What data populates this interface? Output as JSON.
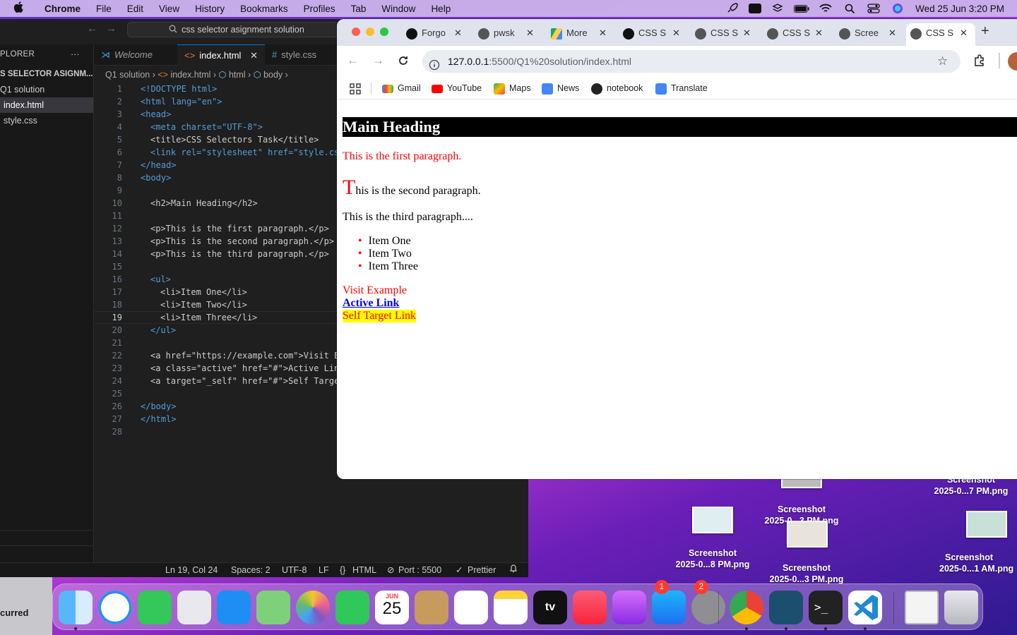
{
  "menubar": {
    "app_name": "Chrome",
    "menus": [
      "File",
      "Edit",
      "View",
      "History",
      "Bookmarks",
      "Profiles",
      "Tab",
      "Window",
      "Help"
    ],
    "datetime": "Wed 25 Jun  3:20 PM"
  },
  "vscode": {
    "search": "css selector asignment solution",
    "explorer_title": "PLORER",
    "explorer_more": "···",
    "project_name": "S SELECTOR ASIGNM...",
    "folder": "Q1 solution",
    "files": [
      "index.html",
      "style.css"
    ],
    "tabs": [
      {
        "label": "Welcome"
      },
      {
        "label": "index.html"
      },
      {
        "label": "style.css"
      }
    ],
    "breadcrumb": [
      "Q1 solution",
      "index.html",
      "html",
      "body"
    ],
    "line_numbers": [
      "1",
      "2",
      "3",
      "4",
      "5",
      "6",
      "7",
      "8",
      "9",
      "10",
      "11",
      "12",
      "13",
      "14",
      "15",
      "16",
      "17",
      "18",
      "19",
      "20",
      "21",
      "22",
      "23",
      "24",
      "25",
      "26",
      "27",
      "28"
    ],
    "code_text": {
      "l1": "<!DOCTYPE html>",
      "l2": "<html lang=\"en\">",
      "l3": "<head>",
      "l4": "<meta charset=\"UTF-8\">",
      "l5": "<title>CSS Selectors Task</title>",
      "l6": "<link rel=\"stylesheet\" href=\"style.cs",
      "l7": "</head>",
      "l8": "<body>",
      "l10": "<h2>Main Heading</h2>",
      "l12": "<p>This is the first paragraph.</p>",
      "l13": "<p>This is the second paragraph.</p>",
      "l14": "<p>This is the third paragraph.</p>",
      "l16": "<ul>",
      "l17": "<li>Item One</li>",
      "l18": "<li>Item Two</li>",
      "l19": "<li>Item Three</li>",
      "l20": "</ul>",
      "l22": "<a href=\"https://example.com\">Visit E",
      "l23": "<a class=\"active\" href=\"#\">Active Lin",
      "l24": "<a target=\"_self\" href=\"#\">Self Targe",
      "l26": "</body>",
      "l27": "</html>"
    },
    "status": {
      "position": "Ln 19, Col 24",
      "spaces": "Spaces: 2",
      "encoding": "UTF-8",
      "eol": "LF",
      "language": "HTML",
      "port": "Port : 5500",
      "formatter": "Prettier"
    }
  },
  "chrome": {
    "tabs": [
      {
        "label": "Forgo"
      },
      {
        "label": "pwsk"
      },
      {
        "label": "More"
      },
      {
        "label": "CSS S"
      },
      {
        "label": "CSS S"
      },
      {
        "label": "CSS S"
      },
      {
        "label": "Scree"
      },
      {
        "label": "CSS S"
      }
    ],
    "new_tab": "+",
    "url_host": "127.0.0.1",
    "url_rest": ":5500/Q1%20solution/index.html",
    "bookmarks": [
      "Gmail",
      "YouTube",
      "Maps",
      "News",
      "notebook",
      "Translate"
    ],
    "page": {
      "heading": "Main Heading",
      "p1": "This is the first paragraph.",
      "p2_first_letter": "T",
      "p2_rest": "his is the second paragraph.",
      "p3": "This is the third paragraph....",
      "list": [
        "Item One",
        "Item Two",
        "Item Three"
      ],
      "link1": "Visit Example",
      "link2": "Active Link",
      "link3": "Self Target Link"
    }
  },
  "desktop": {
    "files": [
      {
        "name": "Screenshot",
        "date": "2025-0...7 PM.png"
      },
      {
        "name": "Screenshot",
        "date": "2025-0...3 PM.png"
      },
      {
        "name": "Screenshot",
        "date": "2025-0...8 PM.png"
      },
      {
        "name": "Screenshot",
        "date": "2025-0...3 PM.png"
      },
      {
        "name": "Screenshot",
        "date": "2025-0...1 AM.png"
      }
    ],
    "partial_window_text": "curred"
  },
  "dock": {
    "calendar_month": "JUN",
    "calendar_day": "25",
    "appstore_badge": "1",
    "settings_badge": "2"
  },
  "colors": {
    "vscode_bg": "#1f1f1f",
    "chrome_accent": "#1a73e8",
    "page_red": "#ff0000",
    "link_blue": "#0000ee",
    "highlight_yellow": "#ffff00"
  }
}
